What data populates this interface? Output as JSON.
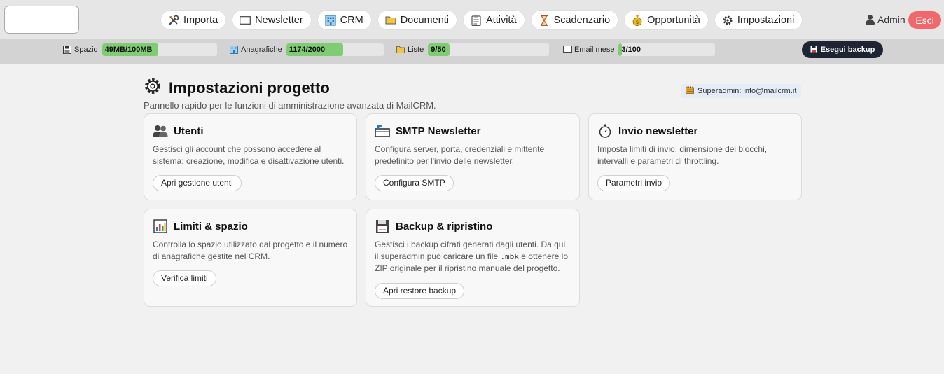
{
  "nav": {
    "items": [
      {
        "label": "Importa",
        "icon": "tools-icon"
      },
      {
        "label": "Newsletter",
        "icon": "envelope-icon"
      },
      {
        "label": "CRM",
        "icon": "building-icon"
      },
      {
        "label": "Documenti",
        "icon": "folder-icon"
      },
      {
        "label": "Attività",
        "icon": "clipboard-icon"
      },
      {
        "label": "Scadenzario",
        "icon": "hourglass-icon"
      },
      {
        "label": "Opportunità",
        "icon": "money-bag-icon"
      },
      {
        "label": "Impostazioni",
        "icon": "gear-icon"
      }
    ],
    "user": "Admin",
    "logout": "Esci"
  },
  "quota": {
    "items": [
      {
        "label": "Spazio",
        "value": "49MB/100MB",
        "fill": 0.49,
        "icon": "floppy-icon"
      },
      {
        "label": "Anagrafiche",
        "value": "1174/2000",
        "fill": 0.587,
        "icon": "building-icon"
      },
      {
        "label": "Liste",
        "value": "9/50",
        "fill": 0.18,
        "icon": "folder-icon"
      },
      {
        "label": "Email mese",
        "value": "3/100",
        "fill": 0.03,
        "icon": "envelope-icon"
      }
    ],
    "backup_label": "Esegui backup"
  },
  "page": {
    "title": "Impostazioni progetto",
    "subtitle": "Pannello rapido per le funzioni di amministrazione avanzata di MailCRM.",
    "superadmin": "Superadmin: info@mailcrm.it"
  },
  "cards": [
    {
      "title": "Utenti",
      "icon": "users-icon",
      "desc": "Gestisci gli account che possono accedere al sistema: creazione, modifica e disattivazione utenti.",
      "button": "Apri gestione utenti"
    },
    {
      "title": "SMTP Newsletter",
      "icon": "mailbox-icon",
      "desc": "Configura server, porta, credenziali e mittente predefinito per l'invio delle newsletter.",
      "button": "Configura SMTP"
    },
    {
      "title": "Invio newsletter",
      "icon": "stopwatch-icon",
      "desc": "Imposta limiti di invio: dimensione dei blocchi, intervalli e parametri di throttling.",
      "button": "Parametri invio"
    },
    {
      "title": "Limiti & spazio",
      "icon": "bar-chart-icon",
      "desc": "Controlla lo spazio utilizzato dal progetto e il numero di anagrafiche gestite nel CRM.",
      "button": "Verifica limiti"
    },
    {
      "title": "Backup & ripristino",
      "icon": "floppy-icon",
      "desc_a": "Gestisci i backup cifrati generati dagli utenti. Da qui il superadmin può caricare un file ",
      "desc_code": ".mbk",
      "desc_b": " e ottenere lo ZIP originale per il ripristino manuale del progetto.",
      "button": "Apri restore backup"
    }
  ]
}
